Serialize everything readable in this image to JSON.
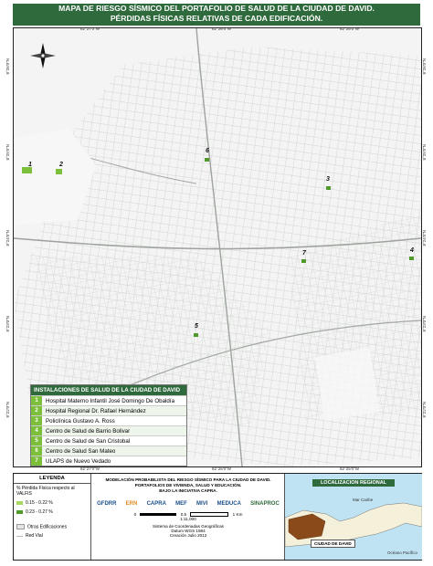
{
  "title": {
    "line1": "MAPA DE RIESGO SÍSMICO DEL PORTAFOLIO DE SALUD DE LA CIUDAD DE DAVID.",
    "line2": "PÉRDIDAS FÍSICAS RELATIVAS DE CADA EDIFICACIÓN."
  },
  "map": {
    "markers": [
      "1",
      "2",
      "3",
      "4",
      "5",
      "6",
      "7"
    ],
    "coords": {
      "top": [
        "82°27'0\"W",
        "82°26'0\"W",
        "82°25'0\"W"
      ],
      "bottom": [
        "82°27'0\"W",
        "82°26'0\"W",
        "82°25'0\"W"
      ],
      "left": [
        "8°26'0\"N",
        "8°25'0\"N",
        "8°24'0\"N",
        "8°23'0\"N",
        "8°22'0\"N"
      ],
      "right": [
        "8°26'0\"N",
        "8°25'0\"N",
        "8°24'0\"N",
        "8°23'0\"N",
        "8°22'0\"N"
      ]
    }
  },
  "installations": {
    "header": "INSTALACIONES DE SALUD DE LA CIUDAD DE DAVID",
    "rows": [
      {
        "num": "1",
        "name": "Hospital Materno Infantil José Domingo De Obaldía"
      },
      {
        "num": "2",
        "name": "Hospital Regional Dr. Rafael Hernández"
      },
      {
        "num": "3",
        "name": "Policlínica Gustavo A. Ross"
      },
      {
        "num": "4",
        "name": "Centro de Salud de Barrio Bolivar"
      },
      {
        "num": "5",
        "name": "Centro de Salud de San Cristobal"
      },
      {
        "num": "6",
        "name": "Centro de Salud San Mateo"
      },
      {
        "num": "7",
        "name": "ULAPS de Nuevo Vedado"
      }
    ]
  },
  "legend": {
    "title": "LEYENDA",
    "subtitle": "% Pérdida Física respecto al VALFIS",
    "items": [
      {
        "label": "0.15 - 0.22 %",
        "color": "#a8d860"
      },
      {
        "label": "0.23 - 0.27 %",
        "color": "#4f9a2a"
      }
    ],
    "others": [
      "Otras Edificaciones",
      "Red Vial"
    ]
  },
  "info": {
    "title_lines": [
      "MODELACIÓN PROBABILISTA DEL RIESGO SÍSMICO PARA LA CIUDAD DE DAVID.",
      "PORTAFOLIOS DE VIVIENDA, SALUD Y EDUCACIÓN.",
      "BAJO LA INICIATIVA CAPRA."
    ],
    "logos": [
      "GFDRR",
      "ERN",
      "CAPRA",
      "MEF",
      "MIVI",
      "MEDUCA",
      "SINAPROC"
    ],
    "scale_ratio": "1:11,000",
    "scale_ticks": [
      "0",
      "0.5",
      "1 Km"
    ],
    "footer": [
      "Sistema de Coordenadas Geográficas",
      "Datum WGS 1984",
      "Creación Julio 2012"
    ]
  },
  "location": {
    "title": "LOCALIZACION REGIONAL",
    "labels": [
      "Mar Caribe",
      "Océano Pacífico"
    ],
    "city_badge": "CIUDAD DE DAVID"
  },
  "colors": {
    "header_green": "#2f6a3d",
    "marker_green": "#7cbf3a",
    "roads": "#c9ccc9",
    "water": "#bfe3f3"
  }
}
